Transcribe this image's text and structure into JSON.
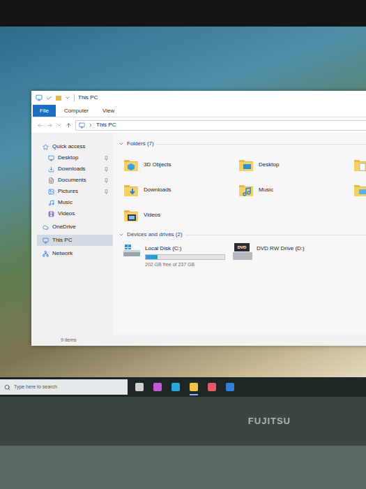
{
  "window": {
    "title": "This PC",
    "status": "9 items"
  },
  "ribbon_tabs": [
    {
      "label": "File",
      "selected": true
    },
    {
      "label": "Computer",
      "selected": false
    },
    {
      "label": "View",
      "selected": false
    }
  ],
  "address": {
    "path": [
      "This PC"
    ]
  },
  "sidebar": {
    "items": [
      {
        "label": "Quick access",
        "kind": "root",
        "pinned": false,
        "selected": false
      },
      {
        "label": "Desktop",
        "kind": "child",
        "pinned": true,
        "selected": false
      },
      {
        "label": "Downloads",
        "kind": "child",
        "pinned": true,
        "selected": false
      },
      {
        "label": "Documents",
        "kind": "child",
        "pinned": true,
        "selected": false
      },
      {
        "label": "Pictures",
        "kind": "child",
        "pinned": true,
        "selected": false
      },
      {
        "label": "Music",
        "kind": "child",
        "pinned": false,
        "selected": false
      },
      {
        "label": "Videos",
        "kind": "child",
        "pinned": false,
        "selected": false
      },
      {
        "label": "OneDrive",
        "kind": "root",
        "pinned": false,
        "selected": false
      },
      {
        "label": "This PC",
        "kind": "root",
        "pinned": false,
        "selected": true
      },
      {
        "label": "Network",
        "kind": "root",
        "pinned": false,
        "selected": false
      }
    ]
  },
  "folders": {
    "heading": "Folders (7)",
    "items": [
      {
        "label": "3D Objects"
      },
      {
        "label": "Desktop"
      },
      {
        "label": ""
      },
      {
        "label": "Downloads"
      },
      {
        "label": "Music"
      },
      {
        "label": ""
      },
      {
        "label": "Videos"
      }
    ]
  },
  "drives": {
    "heading": "Devices and drives (2)",
    "items": [
      {
        "label": "Local Disk (C:)",
        "kind": "disk",
        "level": 0.15,
        "reading": "202 GB free of 237 GB",
        "badge": ""
      },
      {
        "label": "DVD RW Drive (D:)",
        "kind": "dvd",
        "level": 0,
        "reading": "",
        "badge": "DVD"
      }
    ]
  },
  "taskbar": {
    "search_placeholder": "Type here to search"
  },
  "laptop": {
    "brand": "FUJITSU"
  }
}
